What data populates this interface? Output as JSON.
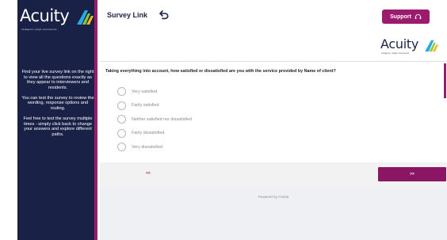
{
  "sidebar": {
    "logo_text": "Acuity",
    "logo_tagline": "intelligence. insight. improvement.",
    "paragraphs": [
      "Find your live survey link on the right to view all the questions exactly as they appear to interviewers and residents.",
      "You can test the survey to review the wording, response options and routing.",
      "Feel free to test the survey multiple times - simply click back to change your answers and explore different paths."
    ]
  },
  "topbar": {
    "title": "Survey Link",
    "back_icon": "return-arrow-icon",
    "support_label": "Support",
    "support_icon": "headset-icon"
  },
  "survey": {
    "logo_text": "Acuity",
    "logo_tagline": "intelligence. insight. improvement.",
    "question": "Taking everything into account, how satisfied or dissatisfied are you with the service provided by Name of client?",
    "options": [
      "Very satisfied",
      "Fairly satisfied",
      "Neither satisfied nor dissatisfied",
      "Fairly dissatisfied",
      "Very dissatisfied"
    ],
    "prev_label": "<<",
    "next_label": ">>",
    "powered_by": "Powered by Forsta"
  },
  "colors": {
    "sidebar_bg": "#1a2147",
    "accent": "#9b1b6e",
    "logo_stripe_blue": "#2aa8e0",
    "logo_stripe_green": "#8dc63f",
    "logo_stripe_yellow": "#f5b81c"
  }
}
